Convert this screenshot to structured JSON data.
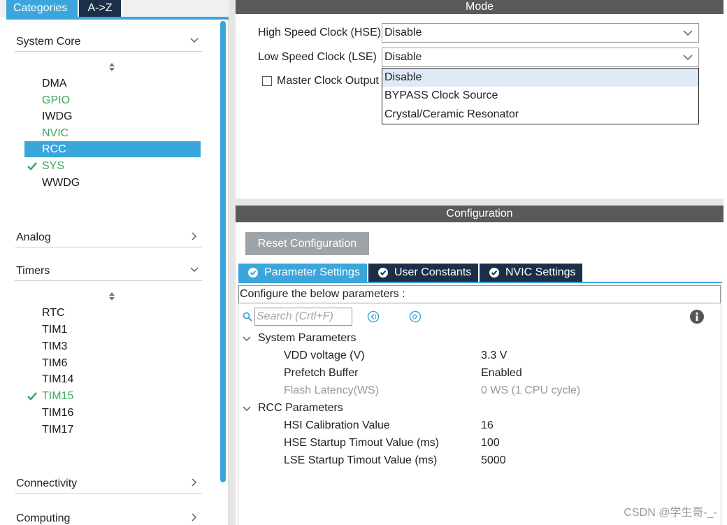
{
  "left_panel": {
    "tabs": {
      "categories": "Categories",
      "az": "A->Z"
    },
    "categories": [
      {
        "label": "System Core",
        "expanded": true
      },
      {
        "label": "Analog",
        "expanded": false
      },
      {
        "label": "Timers",
        "expanded": true
      },
      {
        "label": "Connectivity",
        "expanded": false
      },
      {
        "label": "Computing",
        "expanded": false
      }
    ],
    "system_core_items": [
      {
        "label": "DMA",
        "state": "normal"
      },
      {
        "label": "GPIO",
        "state": "configured"
      },
      {
        "label": "IWDG",
        "state": "normal"
      },
      {
        "label": "NVIC",
        "state": "configured"
      },
      {
        "label": "RCC",
        "state": "selected"
      },
      {
        "label": "SYS",
        "state": "checked"
      },
      {
        "label": "WWDG",
        "state": "normal"
      }
    ],
    "timer_items": [
      {
        "label": "RTC",
        "state": "normal"
      },
      {
        "label": "TIM1",
        "state": "normal"
      },
      {
        "label": "TIM3",
        "state": "normal"
      },
      {
        "label": "TIM6",
        "state": "normal"
      },
      {
        "label": "TIM14",
        "state": "normal"
      },
      {
        "label": "TIM15",
        "state": "checked"
      },
      {
        "label": "TIM16",
        "state": "normal"
      },
      {
        "label": "TIM17",
        "state": "normal"
      }
    ]
  },
  "mode": {
    "title": "Mode",
    "hse_label": "High Speed Clock (HSE)",
    "hse_value": "Disable",
    "lse_label": "Low Speed Clock (LSE)",
    "lse_value": "Disable",
    "master_clock_label": "Master Clock Output",
    "master_clock_checked": false,
    "lse_dropdown_options": [
      "Disable",
      "BYPASS Clock Source",
      "Crystal/Ceramic Resonator"
    ],
    "lse_dropdown_highlighted": "Disable"
  },
  "configuration": {
    "title": "Configuration",
    "reset_label": "Reset Configuration",
    "tabs": [
      "Parameter Settings",
      "User Constants",
      "NVIC Settings"
    ],
    "active_tab": "Parameter Settings",
    "configure_text": "Configure the below parameters :",
    "search_placeholder": "Search (Crtl+F)",
    "groups": [
      {
        "label": "System Parameters",
        "params": [
          {
            "name": "VDD voltage (V)",
            "value": "3.3 V",
            "enabled": true
          },
          {
            "name": "Prefetch Buffer",
            "value": "Enabled",
            "enabled": true
          },
          {
            "name": "Flash Latency(WS)",
            "value": "0 WS (1 CPU cycle)",
            "enabled": false
          }
        ]
      },
      {
        "label": "RCC Parameters",
        "params": [
          {
            "name": "HSI Calibration Value",
            "value": "16",
            "enabled": true
          },
          {
            "name": "HSE Startup Timout Value (ms)",
            "value": "100",
            "enabled": true
          },
          {
            "name": "LSE Startup Timout Value (ms)",
            "value": "5000",
            "enabled": true
          }
        ]
      }
    ]
  },
  "watermark": "CSDN @学生哥-_-",
  "colors": {
    "accent_blue": "#3aa6dc",
    "navy_tab": "#1c2f4a",
    "header_gray": "#5a5a5a",
    "configured_green": "#3aaa5a",
    "button_gray": "#9ea3a8"
  },
  "icons": {
    "expand": "chevron-down-icon",
    "collapse": "chevron-right-icon",
    "check": "check-icon",
    "tab": "check-circle-icon",
    "search": "search-icon",
    "prev": "arrow-left-circle-icon",
    "next": "arrow-right-circle-icon",
    "info": "info-icon"
  }
}
